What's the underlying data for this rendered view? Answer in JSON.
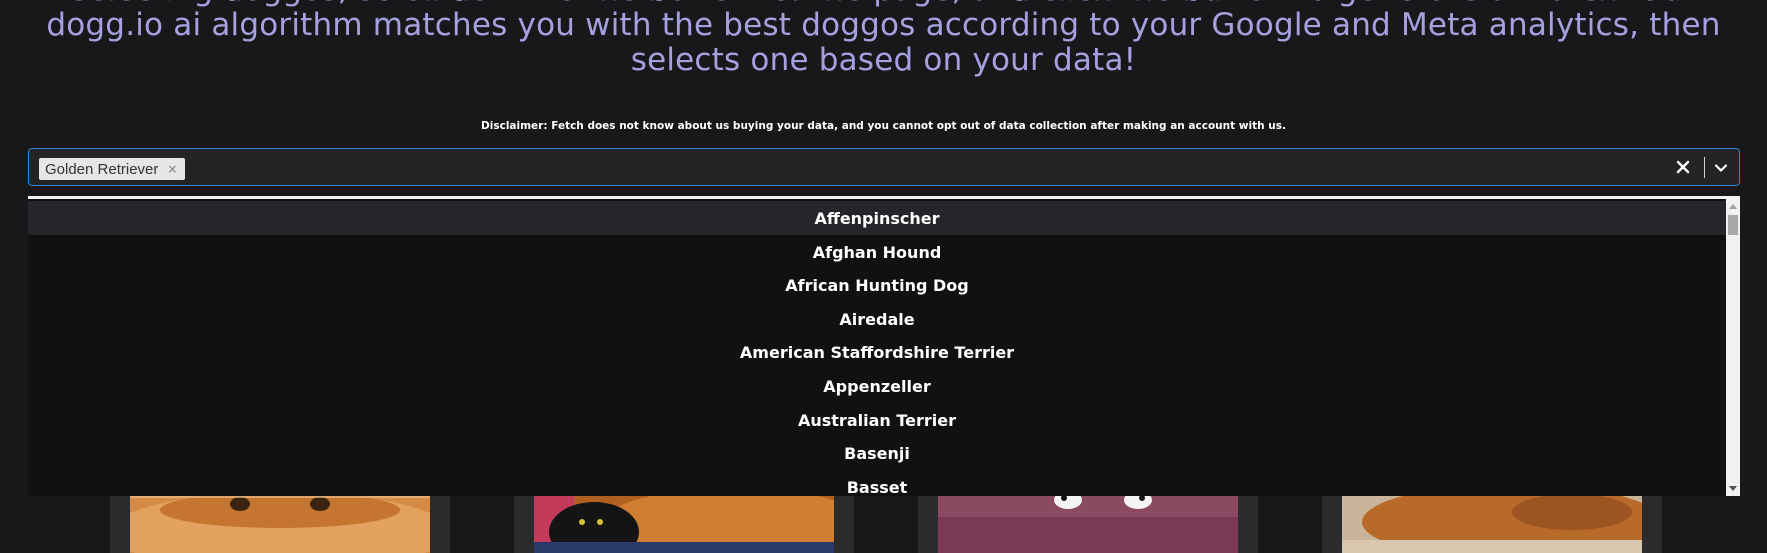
{
  "intro": {
    "lines": [
      "selecting doggos, scroll down to the bottom of the page, and click the button to generate a match. Our",
      "dogg.io ai algorithm matches you with the best doggos according to your Google and Meta analytics, then",
      "selects one based on your data!"
    ]
  },
  "disclaimer": "Disclaimer: Fetch does not know about us buying your data, and you cannot opt out of data collection after making an account with us.",
  "breed_select": {
    "selected": [
      "Golden Retriever"
    ],
    "remove_glyph": "×",
    "clear_icon": "close-icon",
    "dropdown_icon": "chevron-down-icon",
    "focused_index": 0,
    "options": [
      "Affenpinscher",
      "Afghan Hound",
      "African Hunting Dog",
      "Airedale",
      "American Staffordshire Terrier",
      "Appenzeller",
      "Australian Terrier",
      "Basenji",
      "Basset"
    ]
  },
  "colors": {
    "page_bg": "#18181b",
    "intro_text": "#a5a0e0",
    "focus_border": "#2f86d6",
    "menu_bg": "#111112",
    "option_focused_bg": "#26262a"
  }
}
